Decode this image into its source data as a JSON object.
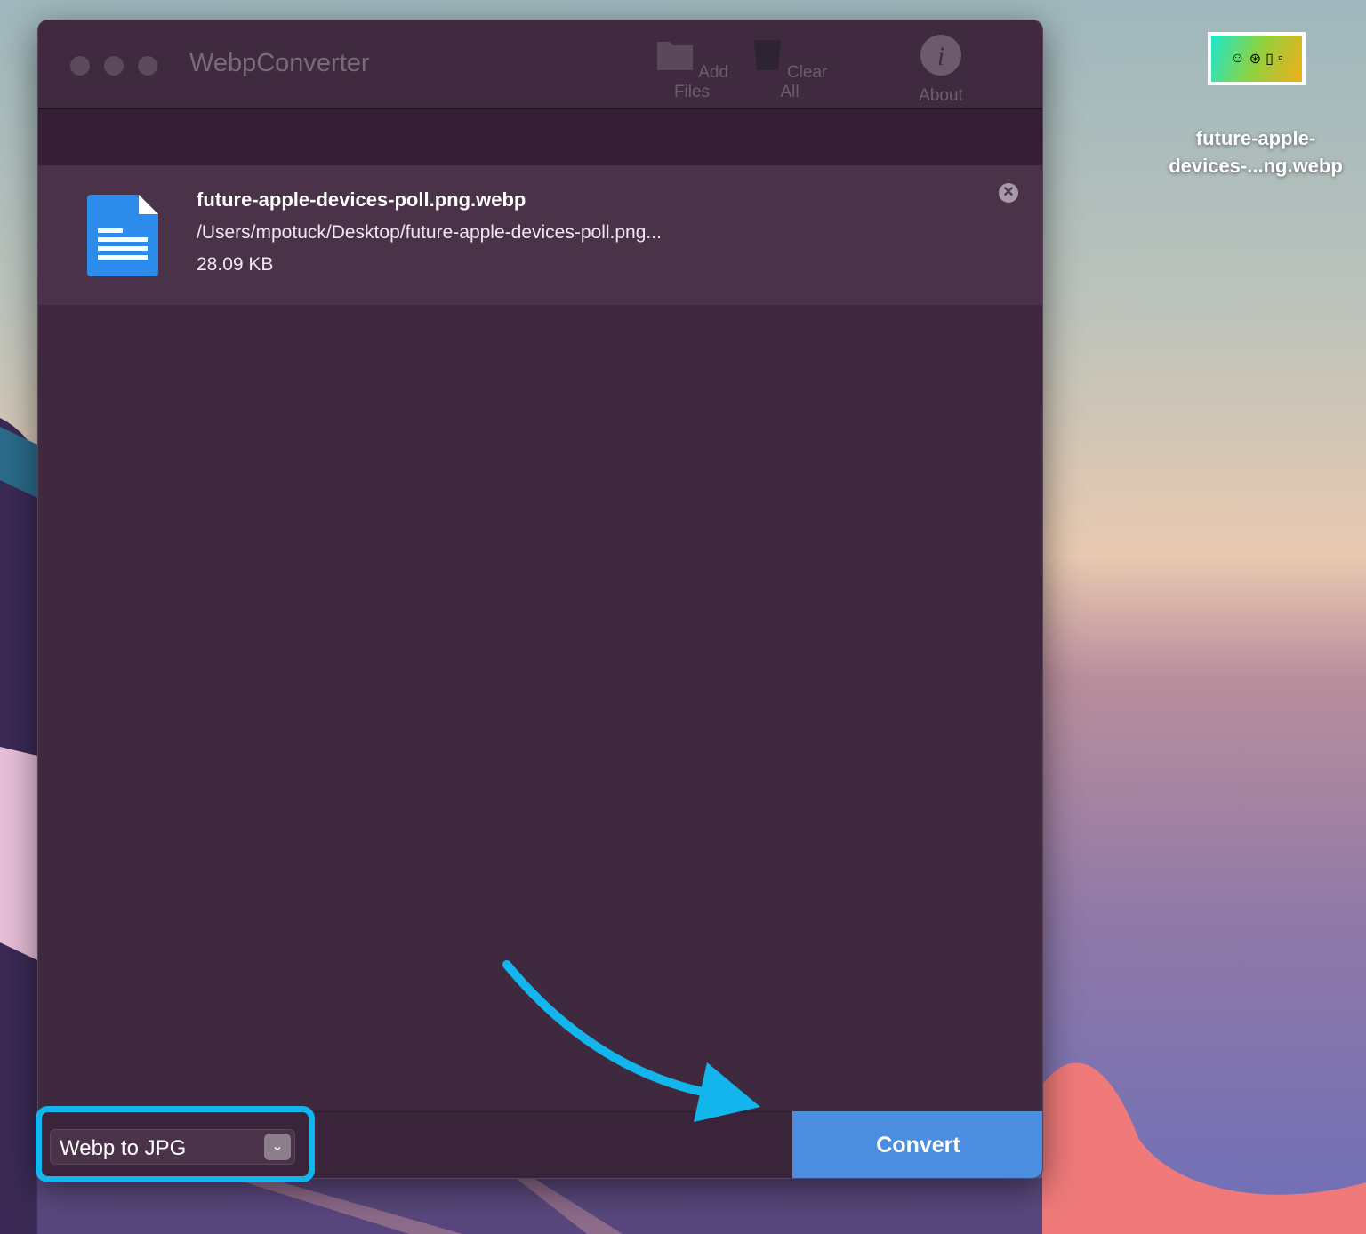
{
  "window": {
    "title": "WebpConverter"
  },
  "toolbar": {
    "add_files": "Add Files",
    "clear_all": "Clear All",
    "about": "About"
  },
  "files": [
    {
      "name": "future-apple-devices-poll.png.webp",
      "path": "/Users/mpotuck/Desktop/future-apple-devices-poll.png...",
      "size": "28.09 KB",
      "icon": "document-icon"
    }
  ],
  "footer": {
    "format_selected": "Webp to JPG",
    "convert_label": "Convert"
  },
  "desktop": {
    "file_label_line1": "future-apple-",
    "file_label_line2": "devices-...ng.webp"
  },
  "colors": {
    "accent": "#4b8ee0",
    "annotation": "#13b6ec"
  }
}
